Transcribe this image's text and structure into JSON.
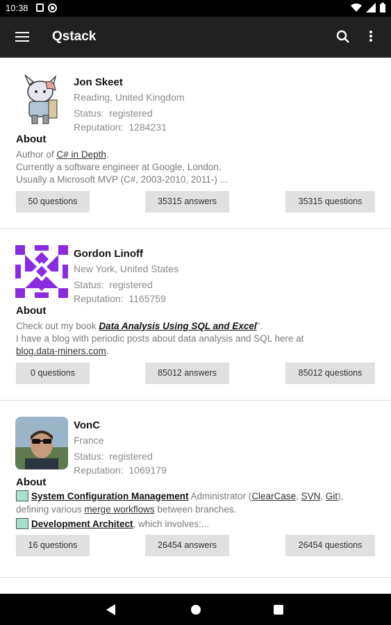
{
  "status_bar": {
    "time": "10:38"
  },
  "app_bar": {
    "title": "Qstack"
  },
  "users": [
    {
      "name": "Jon Skeet",
      "location": "Reading, United Kingdom",
      "status_label": "Status:",
      "status_value": "registered",
      "reputation_label": "Reputation:",
      "reputation_value": "1284231",
      "about_label": "About",
      "bio": {
        "l1_pre": "Author of ",
        "l1_link": "C# in Depth",
        "l1_post": ".",
        "l2": "Currently a software engineer at Google, London.",
        "l3": "Usually a Microsoft MVP (C#, 2003-2010, 2011-) ..."
      },
      "questions_btn": "50 questions",
      "answers_btn": "35315 answers",
      "questions_btn2": "35315 questions"
    },
    {
      "name": "Gordon Linoff",
      "location": "New York, United States",
      "status_label": "Status:",
      "status_value": "registered",
      "reputation_label": "Reputation:",
      "reputation_value": "1165759",
      "about_label": "About",
      "bio": {
        "l1_pre": "Check out my book ",
        "l1_link": "Data Analysis Using SQL and Excel",
        "l1_post": "\".",
        "l2": "I have a blog with periodic posts about data analysis and SQL here at",
        "l3_link": "blog.data-miners.com",
        "l3_post": "."
      },
      "questions_btn": "0 questions",
      "answers_btn": "85012 answers",
      "questions_btn2": "85012 questions"
    },
    {
      "name": "VonC",
      "location": "France",
      "status_label": "Status:",
      "status_value": "registered",
      "reputation_label": "Reputation:",
      "reputation_value": "1069179",
      "about_label": "About",
      "bio": {
        "l1_link": "System Configuration Management",
        "l1_mid": " Administrator (",
        "l1_l2": "ClearCase",
        "l1_c1": ", ",
        "l1_l3": "SVN",
        "l1_c2": ", ",
        "l1_l4": "Git",
        "l1_post": "),",
        "l2_pre": "defining various ",
        "l2_link": "merge workflows",
        "l2_post": " between branches.",
        "l3_link": "Development Architect",
        "l3_post": ", which involves:..."
      },
      "questions_btn": "16 questions",
      "answers_btn": "26454 answers",
      "questions_btn2": "26454 questions"
    }
  ]
}
